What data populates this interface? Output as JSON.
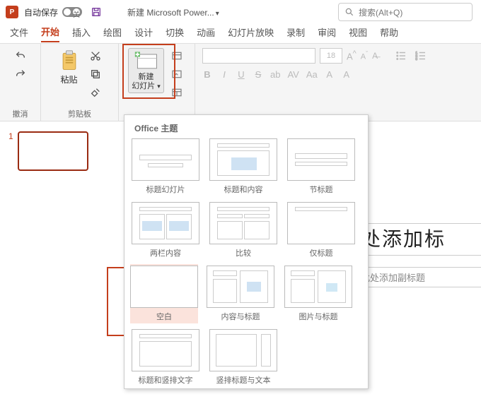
{
  "app": {
    "letter": "P"
  },
  "titlebar": {
    "autosave_label": "自动保存",
    "autosave_state": "关",
    "doc_title": "新建 Microsoft Power...",
    "search_placeholder": "搜索(Alt+Q)"
  },
  "tabs": {
    "items": [
      "文件",
      "开始",
      "插入",
      "绘图",
      "设计",
      "切换",
      "动画",
      "幻灯片放映",
      "录制",
      "审阅",
      "视图",
      "帮助"
    ],
    "active": 1
  },
  "ribbon": {
    "undo_group": "撤消",
    "clipboard_group": "剪贴板",
    "paste_label": "粘贴",
    "newslide_line1": "新建",
    "newslide_line2": "幻灯片",
    "font_size": "18",
    "format_letters": [
      "B",
      "I",
      "U",
      "S",
      "ab",
      "AV",
      "Aa",
      "A",
      "A"
    ]
  },
  "thumbs": {
    "items": [
      {
        "num": "1"
      }
    ]
  },
  "slide": {
    "title_placeholder": "处添加标",
    "subtitle_placeholder": "此处添加副标题"
  },
  "layout_panel": {
    "title": "Office 主题",
    "items": [
      "标题幻灯片",
      "标题和内容",
      "节标题",
      "两栏内容",
      "比较",
      "仅标题",
      "空白",
      "内容与标题",
      "图片与标题",
      "标题和竖排文字",
      "竖排标题与文本"
    ],
    "selected": 6
  }
}
